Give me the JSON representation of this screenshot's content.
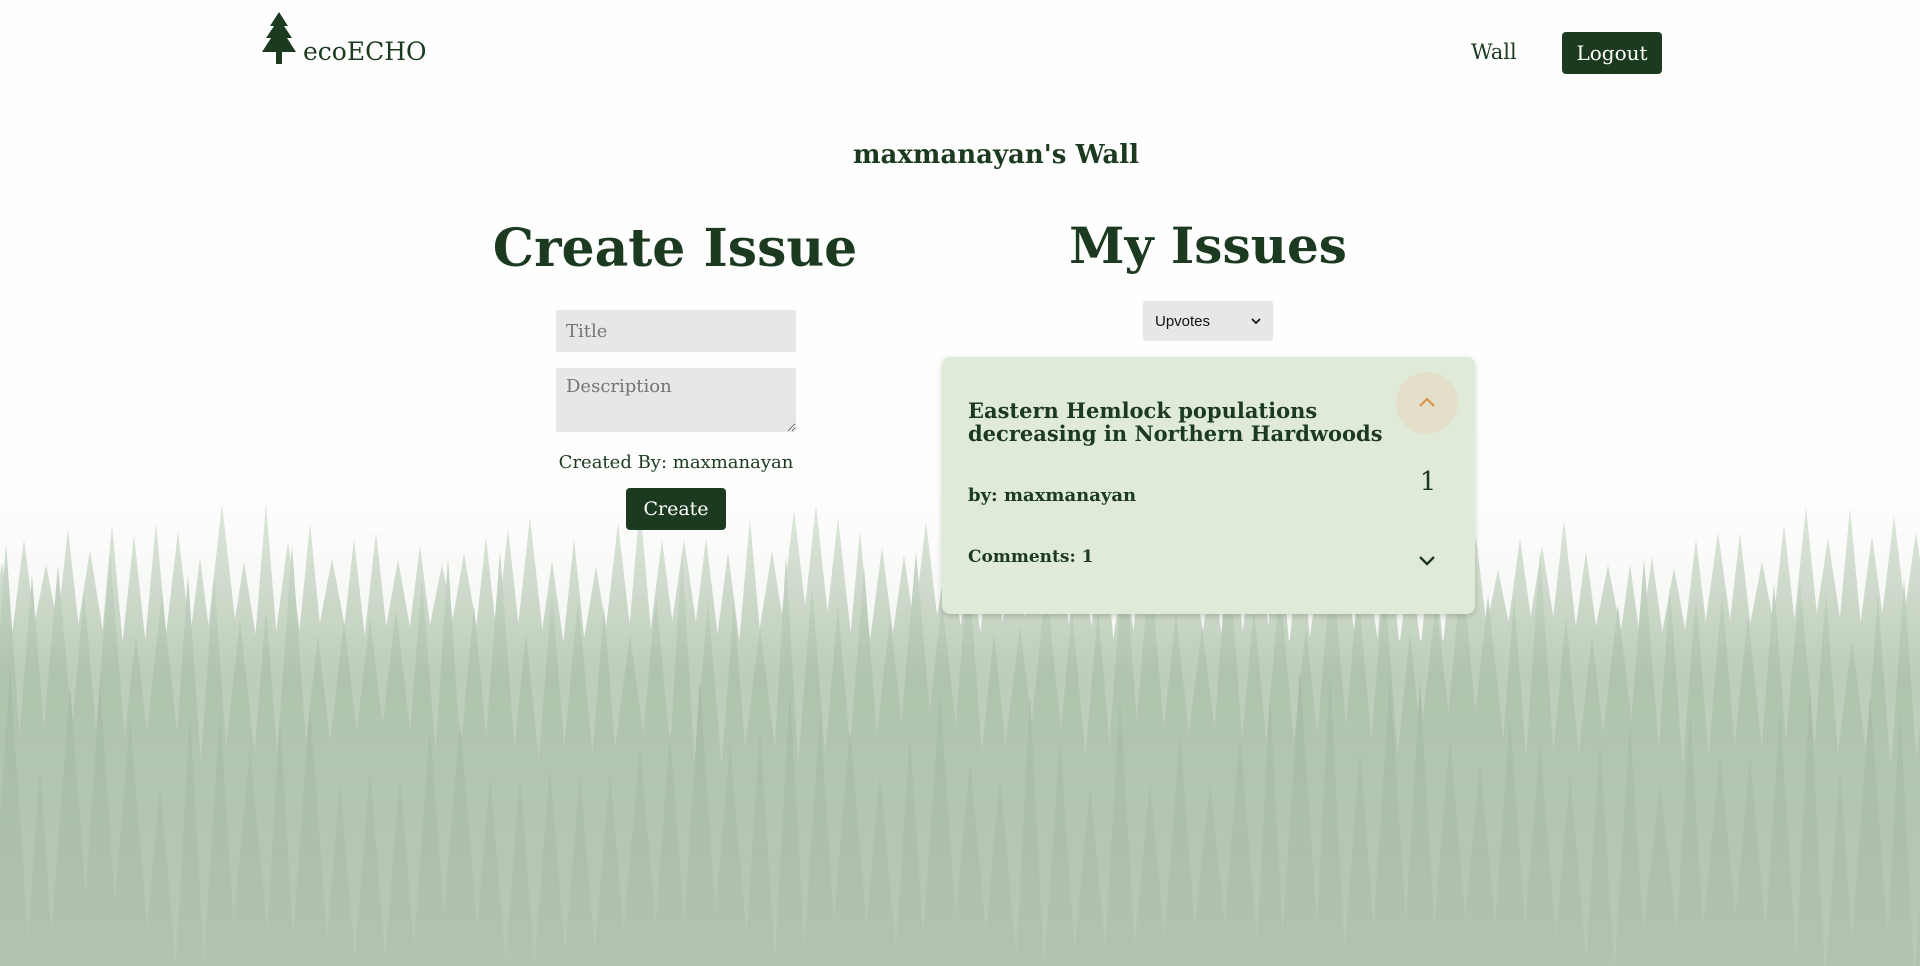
{
  "header": {
    "logo_text": "ecoECHO",
    "nav_wall": "Wall",
    "logout_label": "Logout"
  },
  "wall": {
    "title": "maxmanayan's Wall"
  },
  "create_issue": {
    "heading": "Create Issue",
    "title_placeholder": "Title",
    "description_placeholder": "Description",
    "created_by": "Created By: maxmanayan",
    "create_label": "Create"
  },
  "my_issues": {
    "heading": "My Issues",
    "sort_selected": "Upvotes",
    "issues": [
      {
        "title": "Eastern Hemlock populations decreasing in Northern Hardwoods",
        "author": "by: maxmanayan",
        "votes": "1",
        "comments": "Comments: 1"
      }
    ]
  },
  "colors": {
    "primary": "#1c3a1f",
    "card_bg": "#e0ead9",
    "upvote_bg": "#e4dfc8",
    "upvote_icon": "#d9924a",
    "input_bg": "#e8e6e6"
  },
  "icons": {
    "logo": "pine-tree-icon",
    "upvote": "chevron-up-icon",
    "expand": "chevron-down-icon",
    "select_caret": "caret-down-icon"
  }
}
